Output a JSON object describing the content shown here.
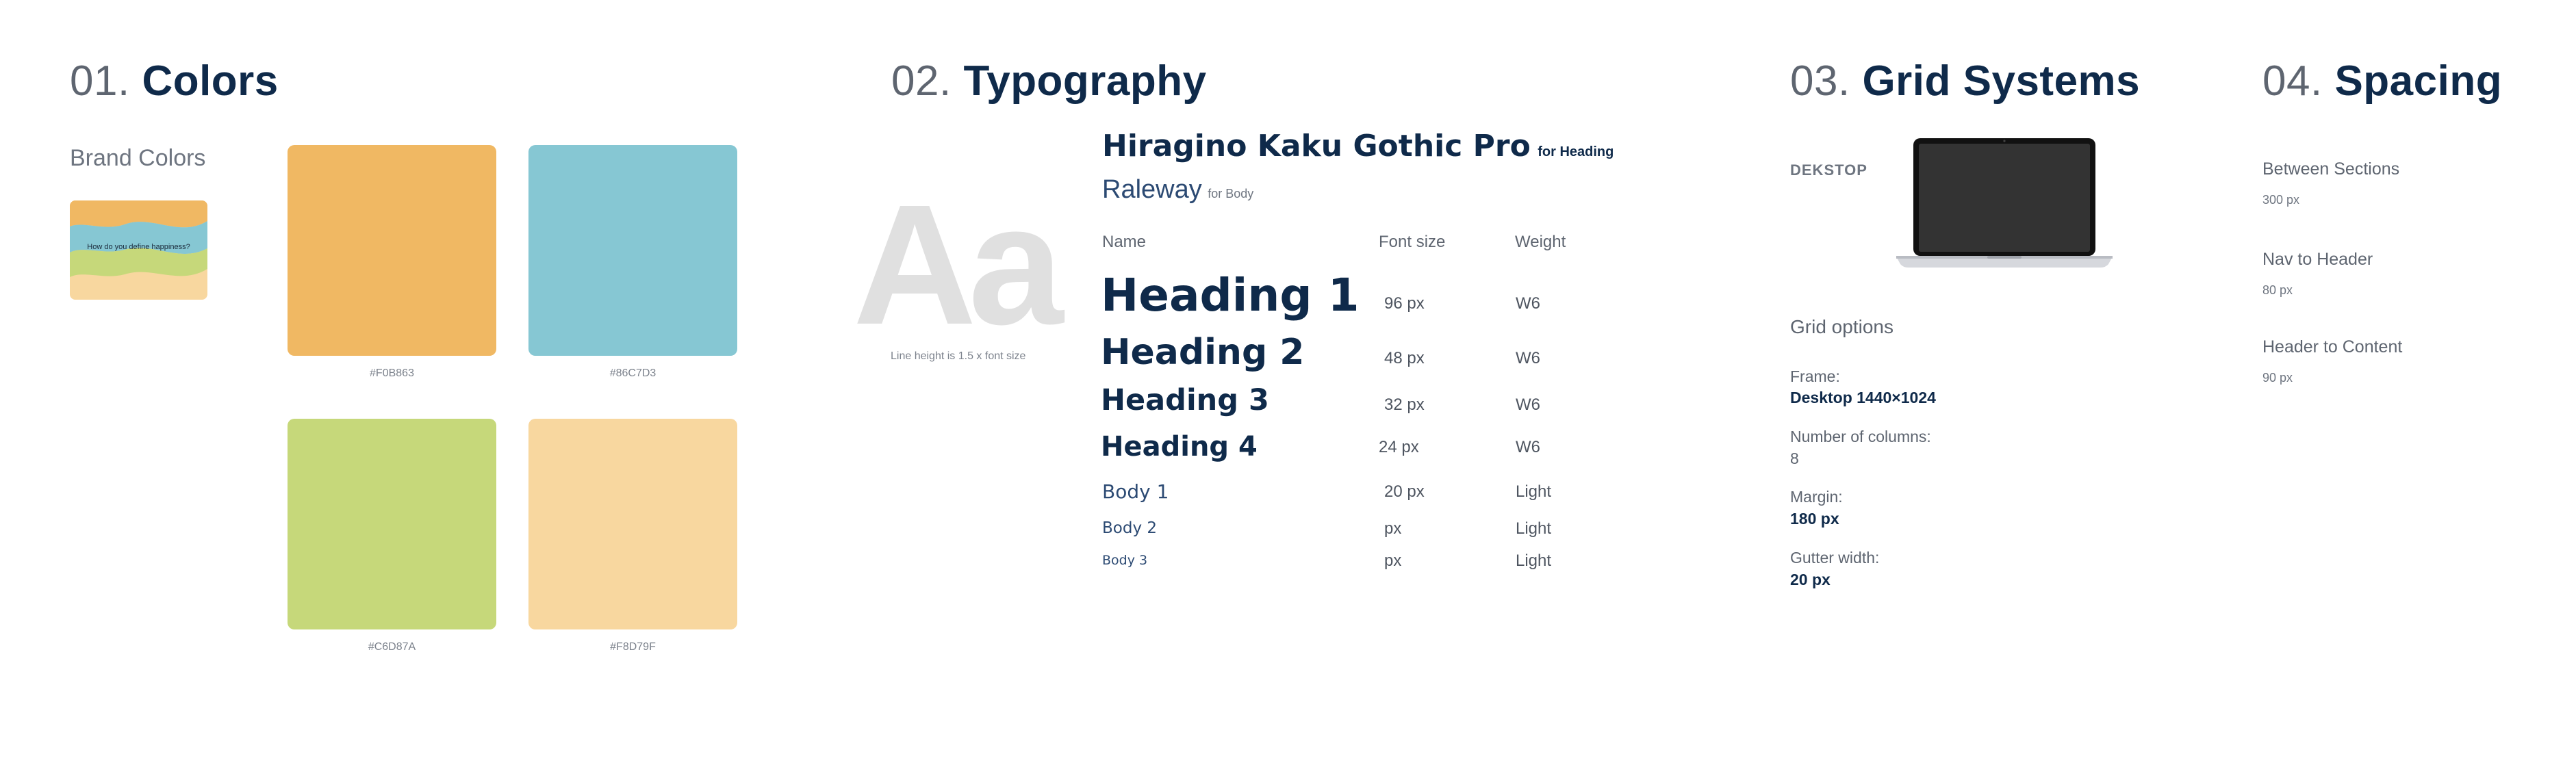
{
  "sections": {
    "colors": {
      "number": "01.",
      "name": "Colors"
    },
    "typography": {
      "number": "02.",
      "name": "Typography"
    },
    "grid": {
      "number": "03.",
      "name": "Grid Systems"
    },
    "spacing": {
      "number": "04.",
      "name": "Spacing"
    }
  },
  "colors": {
    "brand_label": "Brand Colors",
    "thumbnail_text": "How do you define happiness?",
    "swatches": [
      {
        "hex": "#F0B863",
        "color": "#F0B863"
      },
      {
        "hex": "#86C7D3",
        "color": "#86C7D3"
      },
      {
        "hex": "#C6D87A",
        "color": "#C6D87A"
      },
      {
        "hex": "#F8D79F",
        "color": "#F8D79F"
      }
    ]
  },
  "typography": {
    "specimen": "Aa",
    "line_height_note": "Line height is 1.5 x font size",
    "heading_font": "Hiragino Kaku Gothic Pro",
    "heading_font_note": "for Heading",
    "body_font": "Raleway",
    "body_font_note": "for Body",
    "headers": {
      "name": "Name",
      "size": "Font size",
      "weight": "Weight"
    },
    "rows": [
      {
        "name": "Heading 1",
        "size": "96 px",
        "weight": "W6"
      },
      {
        "name": "Heading 2",
        "size": "48 px",
        "weight": "W6"
      },
      {
        "name": "Heading 3",
        "size": "32 px",
        "weight": "W6"
      },
      {
        "name": "Heading 4",
        "size": "24 px",
        "weight": "W6"
      },
      {
        "name": "Body 1",
        "size": "20 px",
        "weight": "Light"
      },
      {
        "name": "Body 2",
        "size": "px",
        "weight": "Light"
      },
      {
        "name": "Body 3",
        "size": "px",
        "weight": "Light"
      }
    ]
  },
  "grid": {
    "device_label": "DEKSTOP",
    "options_title": "Grid options",
    "frame_label": "Frame:",
    "frame_value": "Desktop 1440×1024",
    "columns_label": "Number of columns:",
    "columns_value": "8",
    "margin_label": "Margin:",
    "margin_value": "180 px",
    "gutter_label": "Gutter width:",
    "gutter_value": "20 px"
  },
  "spacing": {
    "items": [
      {
        "label": "Between Sections",
        "value": "300 px"
      },
      {
        "label": "Nav to Header",
        "value": "80 px"
      },
      {
        "label": "Header to Content",
        "value": "90 px"
      }
    ]
  },
  "palette": {
    "navy": "#0F2A4A",
    "specimen_gray": "#E0E0E0",
    "laptop_screen": "#333333"
  }
}
